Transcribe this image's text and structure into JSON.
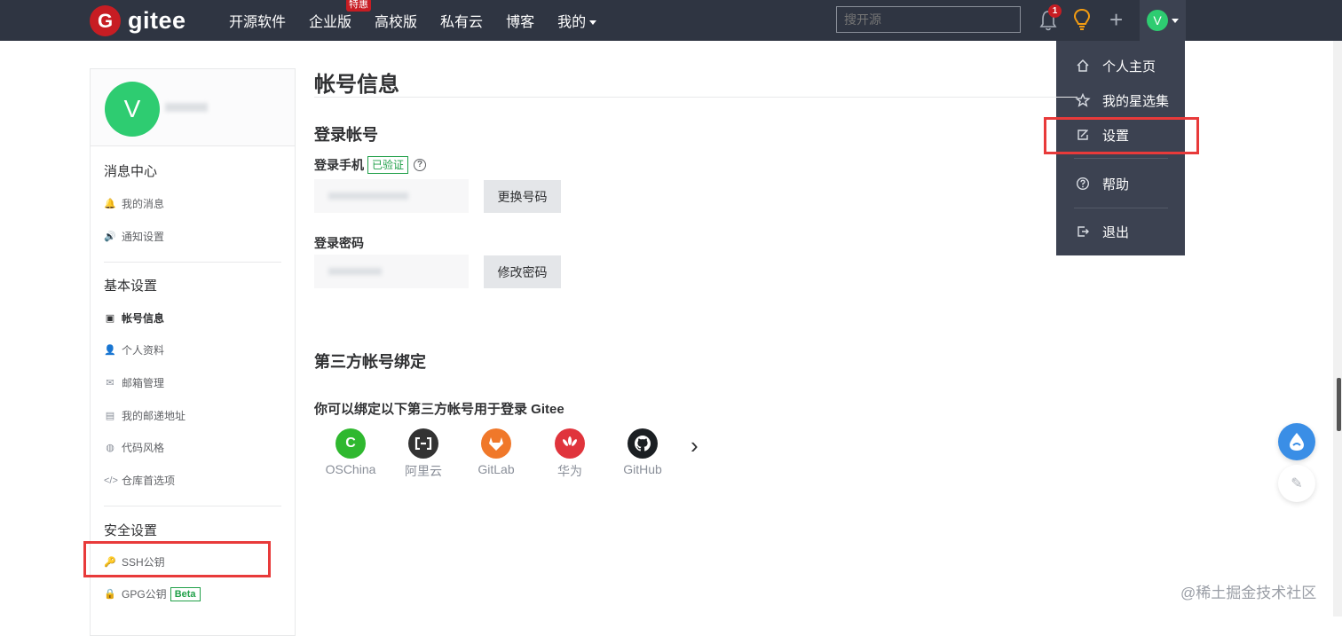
{
  "topbar": {
    "logo_mark": "G",
    "logo_text": "gitee",
    "nav": [
      "开源软件",
      "企业版",
      "高校版",
      "私有云",
      "博客",
      "我的"
    ],
    "enterprise_badge": "特惠",
    "search_placeholder": "搜开源",
    "notification_count": "1",
    "plus_symbol": "+",
    "avatar_letter": "V",
    "icons": [
      "bell-icon",
      "lightbulb-icon",
      "plus-icon",
      "chevron-down-icon"
    ]
  },
  "dropdown": {
    "items": [
      {
        "label": "个人主页",
        "icon": "home-icon"
      },
      {
        "label": "我的星选集",
        "icon": "star-icon"
      },
      {
        "label": "设置",
        "icon": "edit-icon"
      },
      {
        "label": "帮助",
        "icon": "help-icon"
      },
      {
        "label": "退出",
        "icon": "logout-icon"
      }
    ]
  },
  "sidebar": {
    "avatar_letter": "V",
    "sections": [
      {
        "title": "消息中心",
        "items": [
          {
            "label": "我的消息",
            "icon": "bell-icon"
          },
          {
            "label": "通知设置",
            "icon": "speaker-icon"
          }
        ]
      },
      {
        "title": "基本设置",
        "items": [
          {
            "label": "帐号信息",
            "icon": "id-card-icon"
          },
          {
            "label": "个人资料",
            "icon": "user-icon"
          },
          {
            "label": "邮箱管理",
            "icon": "mail-icon"
          },
          {
            "label": "我的邮递地址",
            "icon": "address-card-icon"
          },
          {
            "label": "代码风格",
            "icon": "palette-icon"
          },
          {
            "label": "仓库首选项",
            "icon": "code-icon"
          }
        ]
      },
      {
        "title": "安全设置",
        "items": [
          {
            "label": "SSH公钥",
            "icon": "key-icon"
          },
          {
            "label": "GPG公钥",
            "icon": "lock-icon",
            "badge": "Beta"
          }
        ]
      }
    ]
  },
  "main": {
    "title": "帐号信息",
    "login_section": "登录帐号",
    "phone_label": "登录手机",
    "verified_badge": "已验证",
    "help_symbol": "?",
    "change_phone_button": "更换号码",
    "password_label": "登录密码",
    "change_password_button": "修改密码",
    "third_party_section": "第三方帐号绑定",
    "third_party_desc": "你可以绑定以下第三方帐号用于登录 Gitee",
    "providers": [
      {
        "name": "OSChina",
        "color": "#2fb82f",
        "glyph": "C"
      },
      {
        "name": "阿里云",
        "color": "#333333",
        "glyph": "[-]"
      },
      {
        "name": "GitLab",
        "color": "#f0782a",
        "glyph": "🦊"
      },
      {
        "name": "华为",
        "color": "#e0343c",
        "glyph": "✿"
      },
      {
        "name": "GitHub",
        "color": "#1b1f23",
        "glyph": "🐙"
      }
    ],
    "next_arrow": "›"
  },
  "float_edit_glyph": "✎",
  "watermark": "@稀土掘金技术社区",
  "colors": {
    "topbar": "#2f3542",
    "brand": "#c71d23",
    "avatar": "#2ecc71",
    "highlight": "#e83a3a",
    "verified": "#21a049"
  }
}
